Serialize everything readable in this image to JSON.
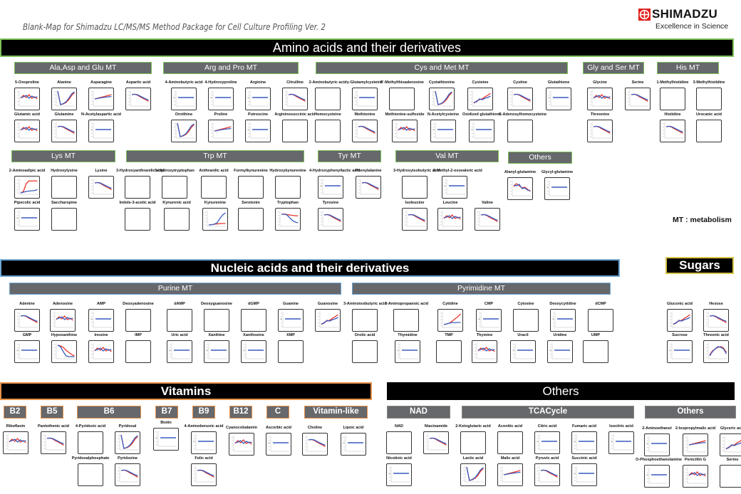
{
  "title": "Blank-Map for Shimadzu LC/MS/MS Method Package for Cell Culture Profiling Ver. 2",
  "logo": {
    "name": "SHIMADZU",
    "tagline": "Excellence in Science",
    "color": "#e0201b"
  },
  "legend": "MT : metabolism",
  "colors": {
    "series_a": "#e8362a",
    "series_b": "#3a5bbf",
    "panel_bg": "#66686b",
    "banner_bg": "#000000"
  },
  "sections": {
    "amino": {
      "title": "Amino acids and their derivatives"
    },
    "nucleic": {
      "title": "Nucleic acids and their derivatives"
    },
    "sugars": {
      "title": "Sugars"
    },
    "vitamins": {
      "title": "Vitamins"
    },
    "others": {
      "title": "Others"
    }
  },
  "groups": [
    {
      "id": "ala",
      "label": "Ala,Asp and Glu MT",
      "items": [
        {
          "name": "5-Oxoproline",
          "plot": "noisy"
        },
        {
          "name": "Alanine",
          "plot": "rise"
        },
        {
          "name": "Asparagine",
          "plot": "slowrise"
        },
        {
          "name": "Aspartic acid",
          "plot": "fall"
        },
        {
          "name": "Glutamic acid",
          "plot": "noisy"
        },
        {
          "name": "Glutamine",
          "plot": "fall"
        },
        {
          "name": "N-Acetylaspartic acid",
          "plot": "flat"
        }
      ]
    },
    {
      "id": "arg",
      "label": "Arg and Pro MT",
      "items": [
        {
          "name": "4-Aminobutyric acid",
          "plot": "flat"
        },
        {
          "name": "4-Hydroxyproline",
          "plot": "flat"
        },
        {
          "name": "Arginine",
          "plot": "flat"
        },
        {
          "name": "Citrulline",
          "plot": "fall"
        },
        {
          "name": "Ornithine",
          "plot": "rise"
        },
        {
          "name": "Proline",
          "plot": "slowrise"
        },
        {
          "name": "Putrescine",
          "plot": "flat"
        },
        {
          "name": "Argininosuccinic acid",
          "plot": "empty"
        }
      ]
    },
    {
      "id": "cys",
      "label": "Cys and Met MT",
      "items": [
        {
          "name": "2-Aminobutyric acid",
          "plot": "empty"
        },
        {
          "name": "γ-Glutamylcysteine",
          "plot": "flat"
        },
        {
          "name": "5'-Methylthioadenosine",
          "plot": "empty"
        },
        {
          "name": "Cystathionine",
          "plot": "rise"
        },
        {
          "name": "Cysteine",
          "plot": "noisyrise"
        },
        {
          "name": "Cystine",
          "plot": "fall"
        },
        {
          "name": "Glutathione",
          "plot": "flat"
        },
        {
          "name": "Homocysteine",
          "plot": "empty"
        },
        {
          "name": "Methionine",
          "plot": "fall"
        },
        {
          "name": "Methionine-sulfoxide",
          "plot": "noisy"
        },
        {
          "name": "N-Acetylcysteine",
          "plot": "flat"
        },
        {
          "name": "Oxidized glutathione",
          "plot": "flat"
        },
        {
          "name": "S-Adenosylhomocysteine",
          "plot": "empty"
        }
      ]
    },
    {
      "id": "gly",
      "label": "Gly and Ser MT",
      "items": [
        {
          "name": "Glycine",
          "plot": "noisy"
        },
        {
          "name": "Serine",
          "plot": "fall"
        },
        {
          "name": "Threonine",
          "plot": "fall"
        }
      ]
    },
    {
      "id": "his",
      "label": "His MT",
      "items": [
        {
          "name": "1-Methylhistidine",
          "plot": "empty"
        },
        {
          "name": "3-Methylhistidine",
          "plot": "empty"
        },
        {
          "name": "Histidine",
          "plot": "fall"
        },
        {
          "name": "Urocanic acid",
          "plot": "empty"
        }
      ]
    },
    {
      "id": "lys",
      "label": "Lys MT",
      "items": [
        {
          "name": "2-Aminoadipic acid",
          "plot": "split"
        },
        {
          "name": "Hydroxylysine",
          "plot": "empty"
        },
        {
          "name": "Lysine",
          "plot": "fall"
        },
        {
          "name": "Pipecolic acid",
          "plot": "flat"
        },
        {
          "name": "Saccharopine",
          "plot": "empty"
        }
      ]
    },
    {
      "id": "trp",
      "label": "Trp MT",
      "items": [
        {
          "name": "3-Hydroxyanthranilic acid",
          "plot": "empty"
        },
        {
          "name": "5-Hydroxytryptophan",
          "plot": "empty"
        },
        {
          "name": "Anthranilic acid",
          "plot": "empty"
        },
        {
          "name": "Formylkynurenine",
          "plot": "empty"
        },
        {
          "name": "Hydroxykynurenine",
          "plot": "empty"
        },
        {
          "name": "Indole-3-acetic acid",
          "plot": "empty"
        },
        {
          "name": "Kynurenic acid",
          "plot": "empty"
        },
        {
          "name": "Kynurenine",
          "plot": "bluerise"
        },
        {
          "name": "Serotonin",
          "plot": "empty"
        },
        {
          "name": "Tryptophan",
          "plot": "bluefall"
        }
      ]
    },
    {
      "id": "tyr",
      "label": "Tyr MT",
      "items": [
        {
          "name": "4-Hydroxyphenyllactic acid",
          "plot": "flat"
        },
        {
          "name": "Phenylalanine",
          "plot": "fall"
        },
        {
          "name": "Tyrosine",
          "plot": "fall"
        }
      ]
    },
    {
      "id": "val",
      "label": "Val MT",
      "items": [
        {
          "name": "3-Hydroxyisobutyric acid",
          "plot": "empty"
        },
        {
          "name": "3-Methyl-2-oxovaleric acid",
          "plot": "flat"
        },
        {
          "name": "Isoleucine",
          "plot": "fall"
        },
        {
          "name": "Leucine",
          "plot": "noisy"
        },
        {
          "name": "Valine",
          "plot": "fall"
        }
      ]
    },
    {
      "id": "aaoth",
      "label": "Others",
      "items": [
        {
          "name": "Alanyl-glutamine",
          "plot": "noisyfall"
        },
        {
          "name": "Glycyl-glutamine",
          "plot": "flat"
        }
      ]
    },
    {
      "id": "purine",
      "label": "Purine MT",
      "items": [
        {
          "name": "Adenine",
          "plot": "fall"
        },
        {
          "name": "Adenosine",
          "plot": "noisy"
        },
        {
          "name": "AMP",
          "plot": "flat"
        },
        {
          "name": "Deoxyadenosine",
          "plot": "empty"
        },
        {
          "name": "dAMP",
          "plot": "empty"
        },
        {
          "name": "Deoxyguanosine",
          "plot": "empty"
        },
        {
          "name": "dGMP",
          "plot": "empty"
        },
        {
          "name": "Guanine",
          "plot": "flat"
        },
        {
          "name": "Guanosine",
          "plot": "noisyrise"
        },
        {
          "name": "GMP",
          "plot": "flat"
        },
        {
          "name": "Hypoxanthine",
          "plot": "dropfast"
        },
        {
          "name": "Inosine",
          "plot": "noisy"
        },
        {
          "name": "IMP",
          "plot": "empty"
        },
        {
          "name": "Uric acid",
          "plot": "flat"
        },
        {
          "name": "Xanthine",
          "plot": "flat"
        },
        {
          "name": "Xanthosine",
          "plot": "flat"
        },
        {
          "name": "XMP",
          "plot": "empty"
        }
      ]
    },
    {
      "id": "pyr",
      "label": "Pyrimidine MT",
      "items": [
        {
          "name": "3-Aminoisobutyric acid",
          "plot": "empty"
        },
        {
          "name": "3-Aminopropanoic acid",
          "plot": "empty"
        },
        {
          "name": "Cytidine",
          "plot": "redrise"
        },
        {
          "name": "CMP",
          "plot": "flat"
        },
        {
          "name": "Cytosine",
          "plot": "empty"
        },
        {
          "name": "Deoxycytidine",
          "plot": "flat"
        },
        {
          "name": "dCMP",
          "plot": "empty"
        },
        {
          "name": "Orotic acid",
          "plot": "empty"
        },
        {
          "name": "Thymidine",
          "plot": "flat"
        },
        {
          "name": "TMP",
          "plot": "empty"
        },
        {
          "name": "Thymine",
          "plot": "noisy"
        },
        {
          "name": "Uracil",
          "plot": "flat"
        },
        {
          "name": "Uridine",
          "plot": "flat"
        },
        {
          "name": "UMP",
          "plot": "empty"
        }
      ]
    },
    {
      "id": "sugars",
      "label": "",
      "items": [
        {
          "name": "Gluconic acid",
          "plot": "noisyrise"
        },
        {
          "name": "Hexose",
          "plot": "fall"
        },
        {
          "name": "Sucrose",
          "plot": "flat"
        },
        {
          "name": "Threonic acid",
          "plot": "hump"
        }
      ]
    },
    {
      "id": "b2",
      "label": "B2",
      "items": [
        {
          "name": "Riboflavin",
          "plot": "noisy"
        }
      ]
    },
    {
      "id": "b5",
      "label": "B5",
      "items": [
        {
          "name": "Pantothenic acid",
          "plot": "fall"
        }
      ]
    },
    {
      "id": "b6",
      "label": "B6",
      "items": [
        {
          "name": "4-Pyridoxic acid",
          "plot": "empty"
        },
        {
          "name": "Pyridoxal",
          "plot": "rise"
        },
        {
          "name": "Pyridoxalphosphate",
          "plot": "empty"
        },
        {
          "name": "Pyridoxine",
          "plot": "fall"
        }
      ]
    },
    {
      "id": "b7",
      "label": "B7",
      "items": [
        {
          "name": "Biotin",
          "plot": "flat"
        }
      ]
    },
    {
      "id": "b9",
      "label": "B9",
      "items": [
        {
          "name": "4-Aminobenzoic acid",
          "plot": "flat"
        },
        {
          "name": "Folic acid",
          "plot": "fall"
        }
      ]
    },
    {
      "id": "b12",
      "label": "B12",
      "items": [
        {
          "name": "Cyanocobalamin",
          "plot": "noisy"
        }
      ]
    },
    {
      "id": "c",
      "label": "C",
      "items": [
        {
          "name": "Ascorbic acid",
          "plot": "flat"
        }
      ]
    },
    {
      "id": "vlike",
      "label": "Vitamin-like",
      "items": [
        {
          "name": "Choline",
          "plot": "fall"
        },
        {
          "name": "Lipoic acid",
          "plot": "flat"
        }
      ]
    },
    {
      "id": "nad",
      "label": "NAD",
      "items": [
        {
          "name": "NAD",
          "plot": "empty"
        },
        {
          "name": "Niacinamide",
          "plot": "fall"
        },
        {
          "name": "Nicotinic acid",
          "plot": "flat"
        }
      ]
    },
    {
      "id": "tca",
      "label": "TCACycle",
      "items": [
        {
          "name": "2-Ketoglutaric acid",
          "plot": "empty"
        },
        {
          "name": "Aconitic acid",
          "plot": "empty"
        },
        {
          "name": "Citric acid",
          "plot": "flat"
        },
        {
          "name": "Fumaric acid",
          "plot": "flat"
        },
        {
          "name": "Isocitric acid",
          "plot": "flat"
        },
        {
          "name": "Lactic acid",
          "plot": "rise"
        },
        {
          "name": "Malic acid",
          "plot": "slowrise"
        },
        {
          "name": "Pyruvic acid",
          "plot": "fall"
        },
        {
          "name": "Succinic acid",
          "plot": "flat"
        }
      ]
    },
    {
      "id": "oth",
      "label": "Others",
      "items": [
        {
          "name": "2-Aminoethanol",
          "plot": "flat"
        },
        {
          "name": "2-Isopropylmalic acid",
          "plot": "slowrise"
        },
        {
          "name": "Glyceric acid",
          "plot": "noisyrise"
        },
        {
          "name": "O-Phosphoethanolamine",
          "plot": "flat"
        },
        {
          "name": "Penicillin G",
          "plot": "noisy"
        },
        {
          "name": "Serine",
          "plot": "empty"
        }
      ]
    }
  ]
}
